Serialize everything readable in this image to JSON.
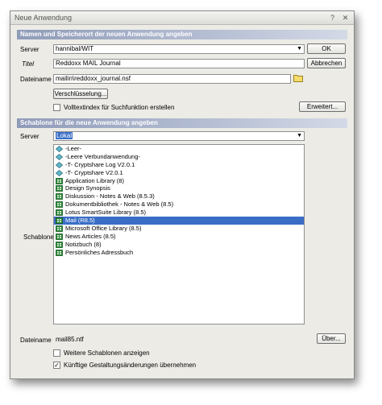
{
  "window": {
    "title": "Neue Anwendung",
    "help_label": "?",
    "close_label": "✕"
  },
  "section1": {
    "header": "Namen und Speicherort der neuen Anwendung angeben",
    "server_label": "Server",
    "server_value": "hannibal/WIT",
    "title_label": "Titel",
    "title_value": "Reddoxx MAIL Journal",
    "filename_label": "Dateiname",
    "filename_value": "mailin\\reddoxx_journal.nsf",
    "encryption_button": "Verschlüsselung...",
    "fulltext_label": "Volltextindex für Suchfunktion erstellen",
    "fulltext_checked": false,
    "advanced_button": "Erweitert...",
    "ok_button": "OK",
    "cancel_button": "Abbrechen"
  },
  "section2": {
    "header": "Schablone für die neue Anwendung angeben",
    "server_label": "Server",
    "server_value": "Lokal",
    "template_label": "Schablone",
    "templates": [
      {
        "label": "-Leer-",
        "icon": "diamond-icon",
        "selected": false
      },
      {
        "label": "-Leere Verbundanwendung-",
        "icon": "diamond-icon",
        "selected": false
      },
      {
        "label": "-T- Cryptshare Log V2.0.1",
        "icon": "diamond-icon",
        "selected": false
      },
      {
        "label": "-T- Cryptshare V2.0.1",
        "icon": "diamond-icon",
        "selected": false
      },
      {
        "label": "Application Library (8)",
        "icon": "database-icon",
        "selected": false
      },
      {
        "label": "Design Synopsis",
        "icon": "database-icon",
        "selected": false
      },
      {
        "label": "Diskussion - Notes & Web (8.5.3)",
        "icon": "database-icon",
        "selected": false
      },
      {
        "label": "Dokumentbibliothek - Notes & Web (8.5)",
        "icon": "database-icon",
        "selected": false
      },
      {
        "label": "Lotus SmartSuite Library (8.5)",
        "icon": "database-icon",
        "selected": false
      },
      {
        "label": "Mail (R8.5)",
        "icon": "database-icon",
        "selected": true
      },
      {
        "label": "Microsoft Office Library (8.5)",
        "icon": "database-icon",
        "selected": false
      },
      {
        "label": "News Articles (8.5)",
        "icon": "database-icon",
        "selected": false
      },
      {
        "label": "Notizbuch (8)",
        "icon": "database-icon",
        "selected": false
      },
      {
        "label": "Persönliches Adressbuch",
        "icon": "database-icon",
        "selected": false
      }
    ],
    "filename_label": "Dateiname",
    "filename_value": "mail85.ntf",
    "browse_button": "Über...",
    "more_templates_label": "Weitere Schablonen anzeigen",
    "more_templates_checked": false,
    "inherit_label": "Künftige Gestaltungsänderungen übernehmen",
    "inherit_checked": true
  },
  "colors": {
    "section_header": "#8f9bb8",
    "selection": "#3a6ec6",
    "dialog_bg": "#ecebe6"
  }
}
